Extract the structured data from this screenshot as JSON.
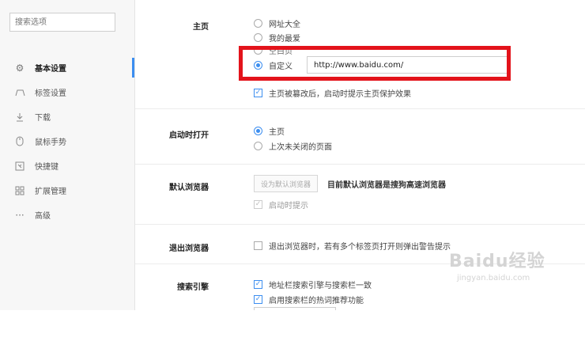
{
  "sidebar": {
    "search_placeholder": "搜索选项",
    "items": [
      {
        "label": "基本设置",
        "icon": "gear-icon"
      },
      {
        "label": "标签设置",
        "icon": "tab-icon"
      },
      {
        "label": "下载",
        "icon": "download-icon"
      },
      {
        "label": "鼠标手势",
        "icon": "mouse-icon"
      },
      {
        "label": "快捷键",
        "icon": "keyboard-icon"
      },
      {
        "label": "扩展管理",
        "icon": "extensions-icon"
      },
      {
        "label": "高级",
        "icon": "more-icon"
      }
    ]
  },
  "homepage": {
    "label": "主页",
    "options": [
      "网址大全",
      "我的最爱",
      "空白页",
      "自定义"
    ],
    "custom_url": "http://www.baidu.com/",
    "protect_label": "主页被篡改后，启动时提示主页保护效果"
  },
  "startup": {
    "label": "启动时打开",
    "options": [
      "主页",
      "上次未关闭的页面"
    ]
  },
  "default_browser": {
    "label": "默认浏览器",
    "button": "设为默认浏览器",
    "status": "目前默认浏览器是搜狗高速浏览器",
    "startup_prompt": "启动时提示"
  },
  "exit_browser": {
    "label": "退出浏览器",
    "warn": "退出浏览器时，若有多个标签页打开则弹出警告提示"
  },
  "search_engine": {
    "label": "搜索引擎",
    "opt1": "地址栏搜索引擎与搜索栏一致",
    "opt2": "启用搜索栏的热词推荐功能"
  },
  "watermark": {
    "logo": "Baidu经验",
    "sub": "jingyan.baidu.com"
  },
  "colors": {
    "accent": "#3c8ef0",
    "highlight": "#e3131b"
  }
}
